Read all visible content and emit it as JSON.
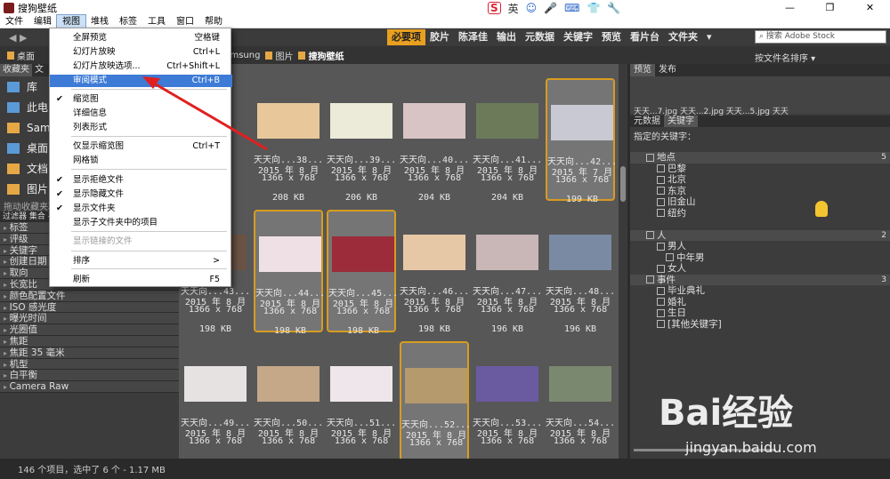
{
  "window": {
    "title": "搜狗壁纸",
    "controls": [
      "—",
      "❐",
      "✕"
    ]
  },
  "ime": {
    "logo": "S",
    "lang": "英",
    "icons": [
      "☺",
      "🎤",
      "⌨",
      "👕",
      "🔧"
    ]
  },
  "menu": [
    "文件",
    "编辑",
    "视图",
    "堆栈",
    "标签",
    "工具",
    "窗口",
    "帮助"
  ],
  "workspaces": [
    "必要项",
    "胶片",
    "陈泽佳",
    "输出",
    "元数据",
    "关键字",
    "预览",
    "看片台",
    "文件夹"
  ],
  "search_placeholder": "搜索 Adobe Stock",
  "breadcrumb": [
    "桌面",
    "Samsung",
    "图片",
    "搜狗壁纸"
  ],
  "sort_label": "按文件名排序",
  "left_tabs": [
    "收藏夹",
    "文"
  ],
  "favorites": [
    "库",
    "此电",
    "Sams",
    "桌面",
    "文档",
    "图片"
  ],
  "fav_hint": "拖动收藏夹项到此处以添加",
  "filter_tabs": "过滤器 集合 导出",
  "filters": [
    "标签",
    "评级",
    "关键字",
    "创建日期",
    "取向",
    "长宽比",
    "颜色配置文件",
    "ISO 感光度",
    "曝光时间",
    "光圈值",
    "焦距",
    "焦距 35 毫米",
    "机型",
    "白平衡",
    "Camera Raw"
  ],
  "thumbnails": [
    {
      "n": "天天向...38...",
      "d": "2015 年 8 月",
      "r": "1366 x 768",
      "s": "208 KB",
      "c": "#e8c89a"
    },
    {
      "n": "天天向...39...",
      "d": "2015 年 8 月",
      "r": "1366 x 768",
      "s": "206 KB",
      "c": "#ecead8"
    },
    {
      "n": "天天向...40...",
      "d": "2015 年 8 月",
      "r": "1366 x 768",
      "s": "204 KB",
      "c": "#d8c4c4"
    },
    {
      "n": "天天向...41...",
      "d": "2015 年 8 月",
      "r": "1366 x 768",
      "s": "204 KB",
      "c": "#6d7a5a"
    },
    {
      "n": "天天向...42...",
      "d": "2015 年 7 月",
      "r": "1366 x 768",
      "s": "199 KB",
      "c": "#c9c9d3"
    },
    {
      "n": "天天向...43...",
      "d": "2015 年 8 月",
      "r": "1366 x 768",
      "s": "198 KB",
      "c": "#6a5244"
    },
    {
      "n": "天天向...44...",
      "d": "2015 年 8 月",
      "r": "1366 x 768",
      "s": "198 KB",
      "c": "#efe0e6"
    },
    {
      "n": "天天向...45...",
      "d": "2015 年 8 月",
      "r": "1366 x 768",
      "s": "198 KB",
      "c": "#9c2c3a"
    },
    {
      "n": "天天向...46...",
      "d": "2015 年 8 月",
      "r": "1366 x 768",
      "s": "198 KB",
      "c": "#e7c8a6"
    },
    {
      "n": "天天向...47...",
      "d": "2015 年 8 月",
      "r": "1366 x 768",
      "s": "196 KB",
      "c": "#c9b6b6"
    },
    {
      "n": "天天向...48...",
      "d": "2015 年 8 月",
      "r": "1366 x 768",
      "s": "196 KB",
      "c": "#7a8aa2"
    },
    {
      "n": "天天向...49...",
      "d": "2015 年 8 月",
      "r": "1366 x 768",
      "s": "",
      "c": "#e6e2e2"
    },
    {
      "n": "天天向...50...",
      "d": "2015 年 8 月",
      "r": "1366 x 768",
      "s": "",
      "c": "#c4a888"
    },
    {
      "n": "天天向...51...",
      "d": "2015 年 8 月",
      "r": "1366 x 768",
      "s": "",
      "c": "#efe6ec"
    },
    {
      "n": "天天向...52...",
      "d": "2015 年 8 月",
      "r": "1366 x 768",
      "s": "",
      "c": "#b49a6c"
    },
    {
      "n": "天天向...53...",
      "d": "2015 年 8 月",
      "r": "1366 x 768",
      "s": "",
      "c": "#6a5aa0"
    },
    {
      "n": "天天向...54...",
      "d": "2015 年 8 月",
      "r": "1366 x 768",
      "s": "",
      "c": "#7a8870"
    }
  ],
  "right_tabs": [
    "预览",
    "发布"
  ],
  "preview_labels": "天天...7.jpg  天天...2.jpg  天天...5.jpg  天天",
  "meta_tabs": [
    "元数据",
    "关键字"
  ],
  "kw_hint": "指定的关键字：",
  "keywords": [
    {
      "label": "地点",
      "cat": true,
      "count": "5"
    },
    {
      "label": "巴黎",
      "cat": false
    },
    {
      "label": "北京",
      "cat": false
    },
    {
      "label": "东京",
      "cat": false
    },
    {
      "label": "旧金山",
      "cat": false
    },
    {
      "label": "纽约",
      "cat": false
    },
    {
      "label": "",
      "cat": false
    },
    {
      "label": "人",
      "cat": true,
      "count": "2"
    },
    {
      "label": "男人",
      "cat": false
    },
    {
      "label": "中年男",
      "cat": false
    },
    {
      "label": "女人",
      "cat": false
    },
    {
      "label": "事件",
      "cat": true,
      "count": "3"
    },
    {
      "label": "毕业典礼",
      "cat": false
    },
    {
      "label": "婚礼",
      "cat": false
    },
    {
      "label": "生日",
      "cat": false
    },
    {
      "label": "[其他关键字]",
      "cat": false
    }
  ],
  "status": "146 个项目，选中了 6 个 - 1.17 MB",
  "watermark": "Bai经验",
  "watermark_url": "jingyan.baidu.com",
  "view_menu": [
    {
      "label": "全屏预览",
      "sc": "空格键"
    },
    {
      "label": "幻灯片放映",
      "sc": "Ctrl+L"
    },
    {
      "label": "幻灯片放映选项...",
      "sc": "Ctrl+Shift+L"
    },
    {
      "label": "审阅模式",
      "sc": "Ctrl+B"
    },
    {
      "label": "缩览图",
      "sc": ""
    },
    {
      "label": "详细信息",
      "sc": ""
    },
    {
      "label": "列表形式",
      "sc": ""
    },
    {
      "label": "仅显示缩览图",
      "sc": "Ctrl+T"
    },
    {
      "label": "网格锁",
      "sc": ""
    },
    {
      "label": "显示拒绝文件",
      "sc": ""
    },
    {
      "label": "显示隐藏文件",
      "sc": ""
    },
    {
      "label": "显示文件夹",
      "sc": ""
    },
    {
      "label": "显示子文件夹中的项目",
      "sc": ""
    },
    {
      "label": "显示链接的文件",
      "sc": ""
    },
    {
      "label": "排序",
      "sc": ">"
    },
    {
      "label": "刷新",
      "sc": "F5"
    }
  ]
}
